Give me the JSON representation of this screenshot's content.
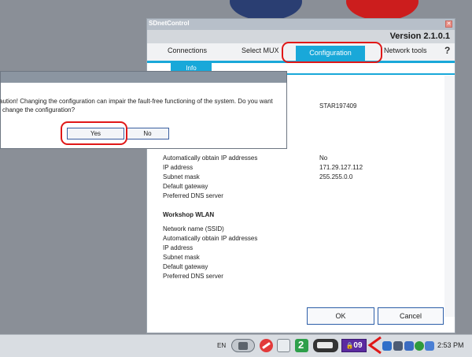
{
  "window": {
    "title": "SDnetControl",
    "version": "Version 2.1.0.1",
    "tabs": [
      "Connections",
      "Select MUX",
      "Configuration",
      "Network tools"
    ],
    "help": "?",
    "subtab": "Info",
    "buttons": {
      "ok": "OK",
      "cancel": "Cancel"
    }
  },
  "info": {
    "name_value": "STAR197409",
    "section1": {
      "labels": [
        "Automatically obtain IP addresses",
        "IP address",
        "Subnet mask",
        "Default gateway",
        "Preferred DNS server"
      ],
      "values": [
        "No",
        "171.29.127.112",
        "255.255.0.0"
      ]
    },
    "section2": {
      "title": "Workshop WLAN",
      "labels": [
        "Network name (SSID)",
        "Automatically obtain IP addresses",
        "IP address",
        "Subnet mask",
        "Default gateway",
        "Preferred DNS server"
      ]
    }
  },
  "dialog": {
    "message_line1": "aution! Changing the configuration can impair the fault-free functioning of the system. Do you want",
    "message_line2": "change the configuration?",
    "yes": "Yes",
    "no": "No"
  },
  "taskbar": {
    "language": "EN",
    "badge": "09",
    "clock": "2:53 PM"
  },
  "colors": {
    "accent": "#19a8d9",
    "highlight": "#e01818",
    "badge": "#5b2ba0"
  }
}
